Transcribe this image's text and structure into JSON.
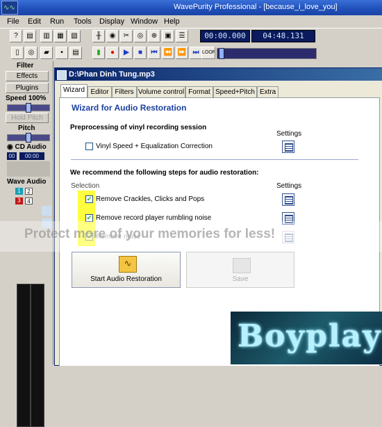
{
  "window": {
    "title_left": "WavePurity Professional",
    "title_right": "[because_i_love_you]"
  },
  "menu": [
    "File",
    "Edit",
    "Run",
    "Tools",
    "Display",
    "Window",
    "Help"
  ],
  "toolbar": {
    "time_current": "00:00.000",
    "time_total": "04:48.131",
    "loop_label": "LOOP"
  },
  "left_panel": {
    "filter_label": "Filter",
    "effects_label": "Effects",
    "plugins_label": "Plugins",
    "speed_label": "Speed 100%",
    "hold_pitch_label": "Hold Pitch",
    "pitch_label": "Pitch",
    "cd_audio_label": "CD Audio",
    "cd_track": "00",
    "cd_time": "00:00",
    "wave_audio_label": "Wave Audio",
    "wave_tracks": [
      "1",
      "2",
      "3",
      "4"
    ]
  },
  "document": {
    "title": "D:\\Phan Dinh Tung.mp3",
    "tabs": [
      "Wizard",
      "Editor",
      "Filters",
      "Volume control",
      "Format",
      "Speed+Pitch",
      "Extra"
    ],
    "active_tab": "Wizard",
    "heading": "Wizard for Audio Restoration",
    "section1_title": "Preprocessing of vinyl recording session",
    "settings_label": "Settings",
    "vinyl_option": "Vinyl Speed + Equalization Correction",
    "section2_title": "We recommend the following steps for audio restoration:",
    "selection_label": "Selection",
    "options": [
      {
        "label": "Remove Crackles, Clicks and Pops",
        "checked": true,
        "enabled": true
      },
      {
        "label": "Remove record player rumbling noise",
        "checked": true,
        "enabled": true
      },
      {
        "label": "Remove noise",
        "checked": true,
        "enabled": false
      }
    ],
    "start_button": "Start Audio Restoration",
    "save_button": "Save"
  },
  "watermark_text": "Protect more of your memories for less!",
  "logo_text": "Boyplay"
}
